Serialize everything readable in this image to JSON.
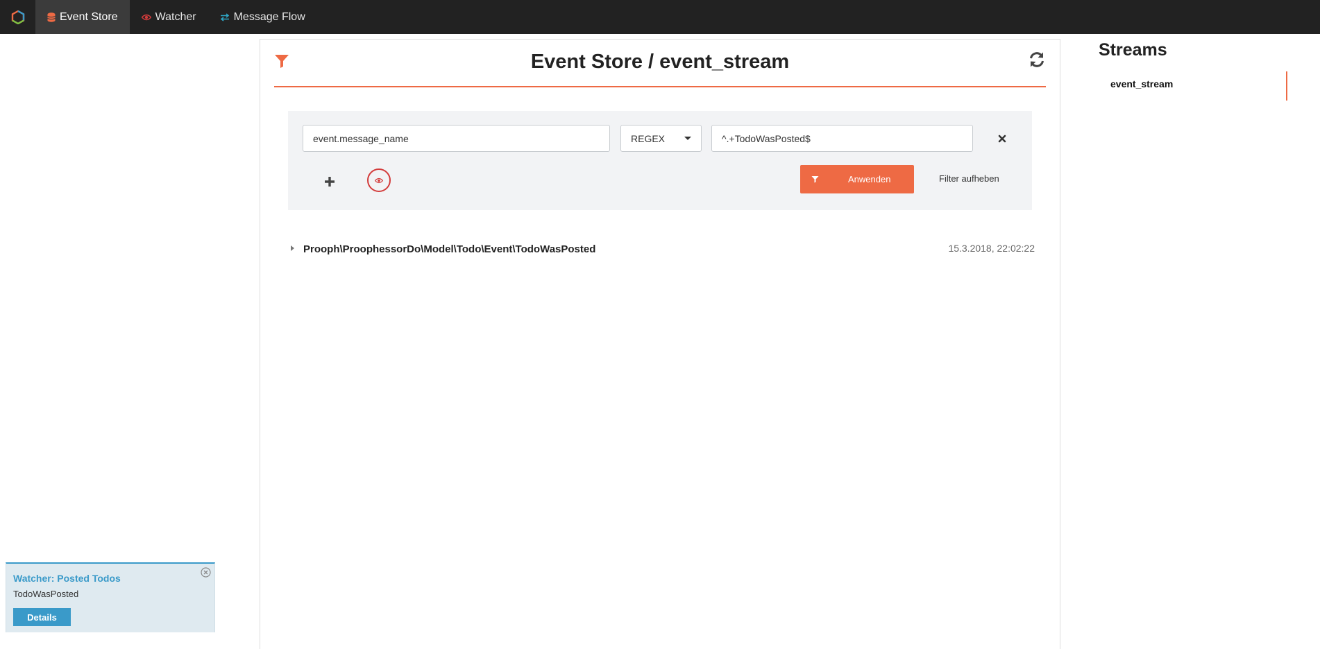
{
  "nav": {
    "items": [
      {
        "label": "Event Store",
        "icon": "database-icon",
        "color": "#ee6a44"
      },
      {
        "label": "Watcher",
        "icon": "eye-icon",
        "color": "#d33b3b"
      },
      {
        "label": "Message Flow",
        "icon": "exchange-icon",
        "color": "#2ea5c4"
      }
    ]
  },
  "header": {
    "title": "Event Store / event_stream"
  },
  "filter": {
    "field_value": "event.message_name",
    "operator": "REGEX",
    "value": "^.+TodoWasPosted$",
    "apply_label": "Anwenden",
    "clear_label": "Filter aufheben"
  },
  "events": [
    {
      "name": "Prooph\\ProophessorDo\\Model\\Todo\\Event\\TodoWasPosted",
      "timestamp": "15.3.2018, 22:02:22"
    }
  ],
  "streams": {
    "title": "Streams",
    "items": [
      {
        "label": "event_stream"
      }
    ]
  },
  "notification": {
    "title": "Watcher: Posted Todos",
    "body": "TodoWasPosted",
    "button_label": "Details"
  },
  "colors": {
    "accent": "#ee6a44",
    "navbar": "#222222",
    "info": "#3a9ac9",
    "danger": "#d33b3b"
  }
}
